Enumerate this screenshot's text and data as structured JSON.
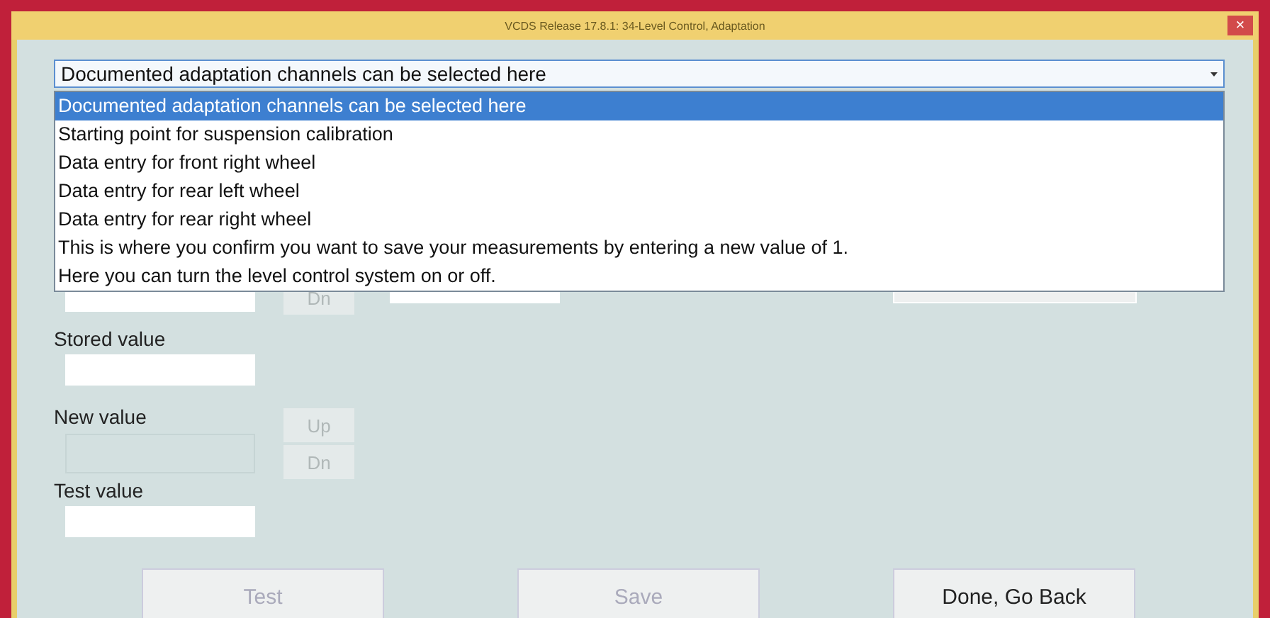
{
  "window": {
    "title": "VCDS Release 17.8.1: 34-Level Control, Adaptation",
    "close_icon": "×"
  },
  "channel_select": {
    "value": "Documented adaptation channels can be selected here",
    "expanded": true,
    "options": [
      {
        "label": "Documented adaptation channels can be selected here",
        "selected": true
      },
      {
        "label": "Starting point for suspension calibration",
        "selected": false
      },
      {
        "label": "Data entry for front right wheel",
        "selected": false
      },
      {
        "label": "Data entry for rear left wheel",
        "selected": false
      },
      {
        "label": "Data entry for rear right wheel",
        "selected": false
      },
      {
        "label": "This is where you confirm you want to save your measurements by entering a new value of 1.",
        "selected": false
      },
      {
        "label": "Here you can turn the level control system on or off.",
        "selected": false
      }
    ]
  },
  "hidden_row": {
    "down_button": "Dn"
  },
  "stored_value": {
    "label": "Stored value"
  },
  "new_value": {
    "label": "New value",
    "disabled": true,
    "up_button": "Up",
    "down_button": "Dn"
  },
  "test_value": {
    "label": "Test value"
  },
  "buttons": [
    {
      "label": "Test",
      "disabled": true
    },
    {
      "label": "Save",
      "disabled": true
    },
    {
      "label": "Done, Go Back",
      "disabled": false
    }
  ]
}
